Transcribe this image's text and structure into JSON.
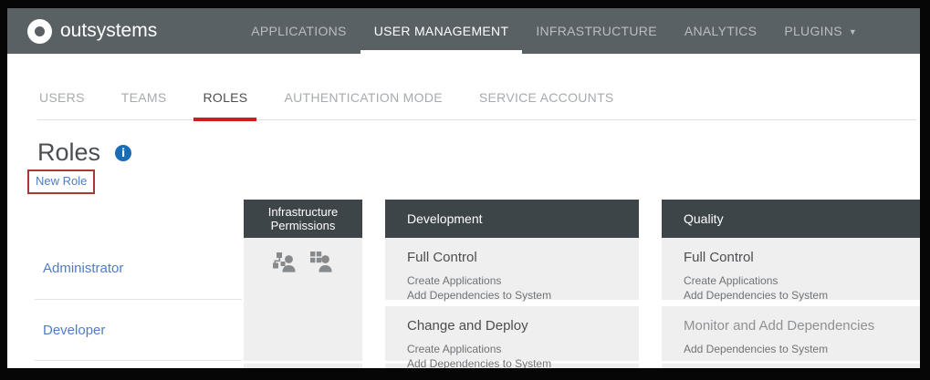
{
  "brand": {
    "name": "outsystems"
  },
  "top_nav": {
    "items": [
      {
        "label": "APPLICATIONS"
      },
      {
        "label": "USER MANAGEMENT"
      },
      {
        "label": "INFRASTRUCTURE"
      },
      {
        "label": "ANALYTICS"
      },
      {
        "label": "PLUGINS"
      }
    ],
    "active": "USER MANAGEMENT",
    "plugins_caret": "▼"
  },
  "tabs": {
    "items": [
      {
        "label": "USERS"
      },
      {
        "label": "TEAMS"
      },
      {
        "label": "ROLES"
      },
      {
        "label": "AUTHENTICATION MODE"
      },
      {
        "label": "SERVICE ACCOUNTS"
      }
    ],
    "active": "ROLES"
  },
  "page": {
    "title": "Roles",
    "new_role_label": "New Role"
  },
  "table": {
    "headers": {
      "infrastructure": "Infrastructure Permissions",
      "development": "Development",
      "quality": "Quality"
    },
    "rows": [
      {
        "role": "Administrator",
        "infrastructure_icons": [
          "org-chart-person-icon",
          "grid-person-icon"
        ],
        "development": {
          "title": "Full Control",
          "permissions": [
            "Create Applications",
            "Add Dependencies to System"
          ]
        },
        "quality": {
          "title": "Full Control",
          "permissions": [
            "Create Applications",
            "Add Dependencies to System"
          ]
        }
      },
      {
        "role": "Developer",
        "infrastructure_icons": [],
        "development": {
          "title": "Change and Deploy",
          "permissions": [
            "Create Applications",
            "Add Dependencies to System"
          ]
        },
        "quality": {
          "title": "Monitor and Add Dependencies",
          "permissions": [
            "Add Dependencies to System"
          ]
        }
      }
    ]
  },
  "colors": {
    "topbar_bg": "#596165",
    "table_header_bg": "#3e4549",
    "active_tab_red": "#c9211a",
    "annotation_box_red": "#a8392e",
    "link_blue": "#4e7dc8",
    "info_icon_blue": "#1a6cb4",
    "cell_bg": "#f0eff0"
  }
}
